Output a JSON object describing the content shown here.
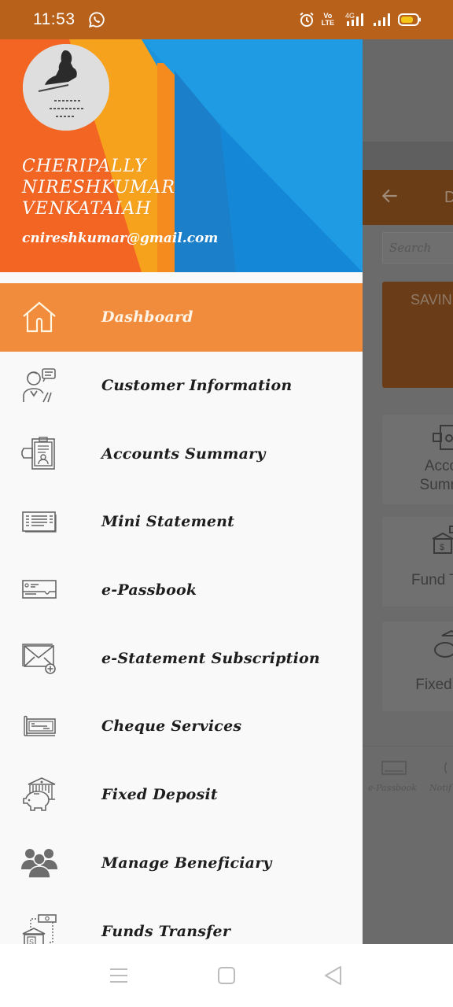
{
  "status_bar": {
    "time": "11:53",
    "notification_icons": [
      "whatsapp-icon"
    ],
    "right_icons": [
      "alarm-icon",
      "volte-icon",
      "4g-signal-icon",
      "signal-icon",
      "battery-icon"
    ],
    "volte_label": "Vo LTE",
    "network_label": "4G",
    "battery_color": "#f5c518"
  },
  "drawer": {
    "header": {
      "user_name_lines": [
        "CHERIPALLY",
        "NIRESHKUMAR",
        "VENKATAIAH"
      ],
      "email": "cnireshkumar@gmail.com",
      "avatar_icon": "profile-photo"
    },
    "active_color": "#f08c3c",
    "items": [
      {
        "label": "Dashboard",
        "icon": "home-icon",
        "active": true
      },
      {
        "label": "Customer Information",
        "icon": "customer-support-icon",
        "active": false
      },
      {
        "label": "Accounts Summary",
        "icon": "account-clipboard-icon",
        "active": false
      },
      {
        "label": "Mini Statement",
        "icon": "statement-icon",
        "active": false
      },
      {
        "label": "e-Passbook",
        "icon": "passbook-icon",
        "active": false
      },
      {
        "label": "e-Statement Subscription",
        "icon": "mail-add-icon",
        "active": false
      },
      {
        "label": "Cheque Services",
        "icon": "cheque-icon",
        "active": false
      },
      {
        "label": "Fixed Deposit",
        "icon": "piggy-bank-icon",
        "active": false
      },
      {
        "label": "Manage Beneficiary",
        "icon": "group-icon",
        "active": false
      },
      {
        "label": "Funds Transfer",
        "icon": "bank-transfer-icon",
        "active": false
      }
    ]
  },
  "background_app": {
    "toolbar_title": "D",
    "search_placeholder": "Search",
    "savings_card_label": "SAVIN",
    "tiles": [
      {
        "label_lines": [
          "Acco",
          "Summ"
        ],
        "icon": "account-clipboard-icon"
      },
      {
        "label_lines": [
          "Fund Tra"
        ],
        "icon": "bank-transfer-icon"
      },
      {
        "label_lines": [
          "Fixed D"
        ],
        "icon": "piggy-bank-icon"
      }
    ],
    "bottom_nav": [
      {
        "label": "e-Passbook",
        "icon": "passbook-icon"
      },
      {
        "label": "Notif",
        "icon": "notification-icon"
      }
    ]
  },
  "nav_bar": {
    "buttons": [
      "menu-button",
      "home-button",
      "back-button"
    ]
  }
}
